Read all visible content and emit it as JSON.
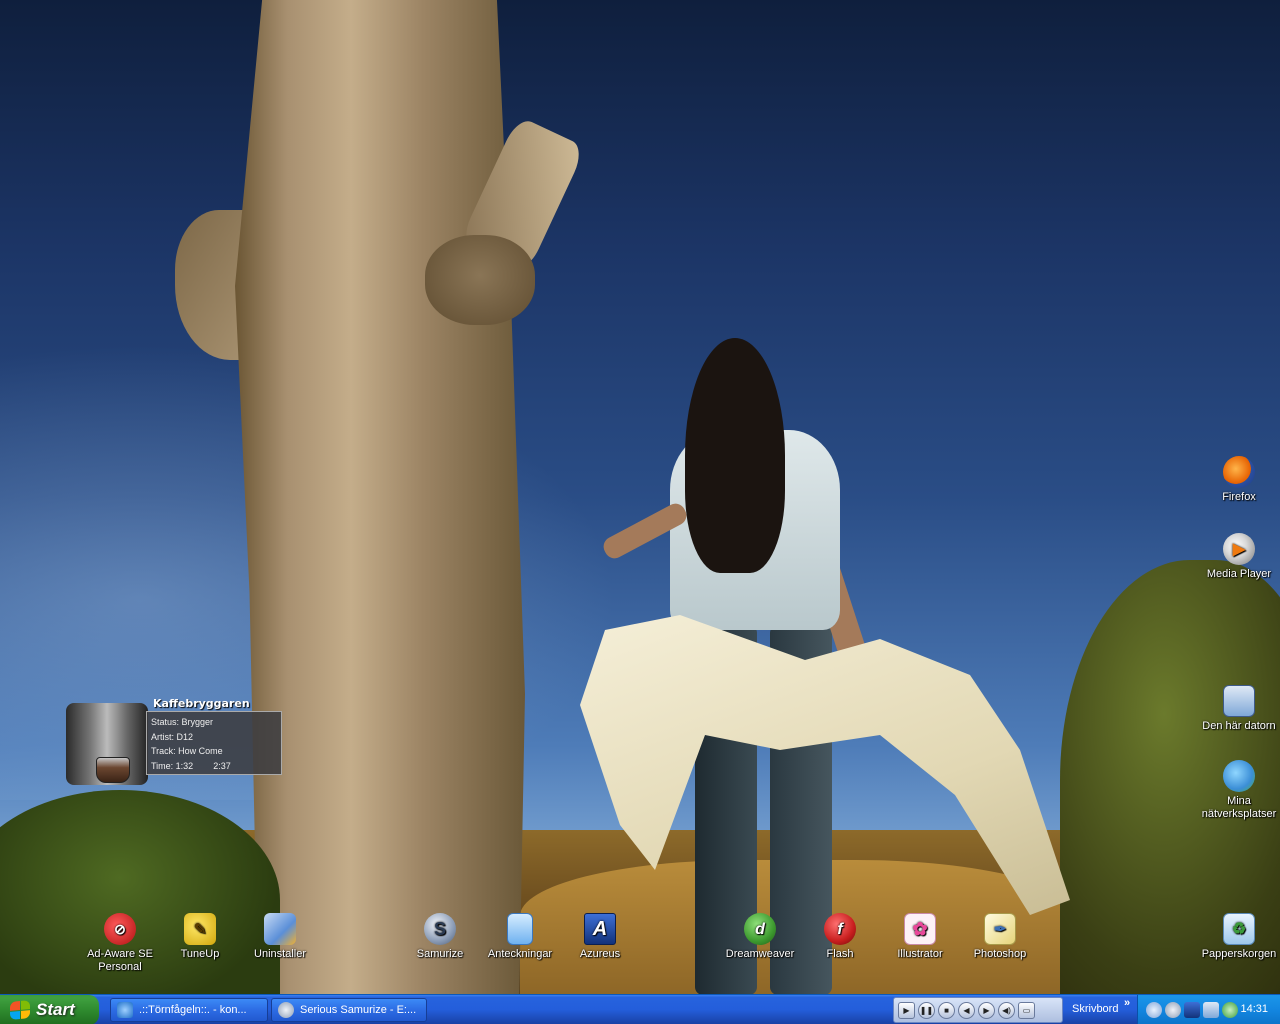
{
  "widget": {
    "title": "Kaffebryggaren",
    "status": "Status: Brygger",
    "artist": "Artist: D12",
    "track": "Track: How Come",
    "time_label": "Time: 1:32",
    "time_total": "2:37"
  },
  "desktop_icons_right": [
    {
      "label": "Firefox",
      "icon": "firefox-icon",
      "color": "#e66000"
    },
    {
      "label": "Media Player",
      "icon": "media-player-icon",
      "color": "#ef7a10"
    },
    {
      "label": "Den här datorn",
      "icon": "computer-icon",
      "color": "#7fa8d8"
    },
    {
      "label": "Mina nätverksplatser",
      "icon": "network-places-icon",
      "color": "#4ab04a"
    },
    {
      "label": "Papperskorgen",
      "icon": "recycle-bin-icon",
      "color": "#5bb35b"
    }
  ],
  "desktop_icons_bottom": [
    {
      "label": "Ad-Aware SE Personal",
      "icon": "ad-aware-icon",
      "color": "#d21f1f"
    },
    {
      "label": "TuneUp",
      "icon": "tuneup-icon",
      "color": "#e5c118"
    },
    {
      "label": "Uninstaller",
      "icon": "uninstaller-icon",
      "color": "#6b9be0"
    },
    {
      "label": "Samurize",
      "icon": "samurize-icon",
      "color": "#8a9bb5"
    },
    {
      "label": "Anteckningar",
      "icon": "notepad-icon",
      "color": "#6fb2f0"
    },
    {
      "label": "Azureus",
      "icon": "azureus-icon",
      "color": "#1d4aa8"
    },
    {
      "label": "Dreamweaver",
      "icon": "dreamweaver-icon",
      "color": "#3d9a2f"
    },
    {
      "label": "Flash",
      "icon": "flash-icon",
      "color": "#c81e1e"
    },
    {
      "label": "Illustrator",
      "icon": "illustrator-icon",
      "color": "#e8479a"
    },
    {
      "label": "Photoshop",
      "icon": "photoshop-icon",
      "color": "#f3e8a8"
    }
  ],
  "taskbar": {
    "start_label": "Start",
    "tasks": [
      {
        "label": ".::Törnfågeln::. - kon...",
        "icon": "ie-icon"
      },
      {
        "label": "Serious Samurize - E:...",
        "icon": "samurize-icon"
      }
    ],
    "media_controls": [
      "Pause",
      "Stop",
      "Previous",
      "Next",
      "Volume"
    ],
    "desktop_toolbar_label": "Skrivbord",
    "chevron": "»",
    "clock": "14:31"
  },
  "colors": {
    "taskbar_blue": "#245edb",
    "start_green": "#3a9a3a",
    "tray_blue": "#1386e0"
  }
}
